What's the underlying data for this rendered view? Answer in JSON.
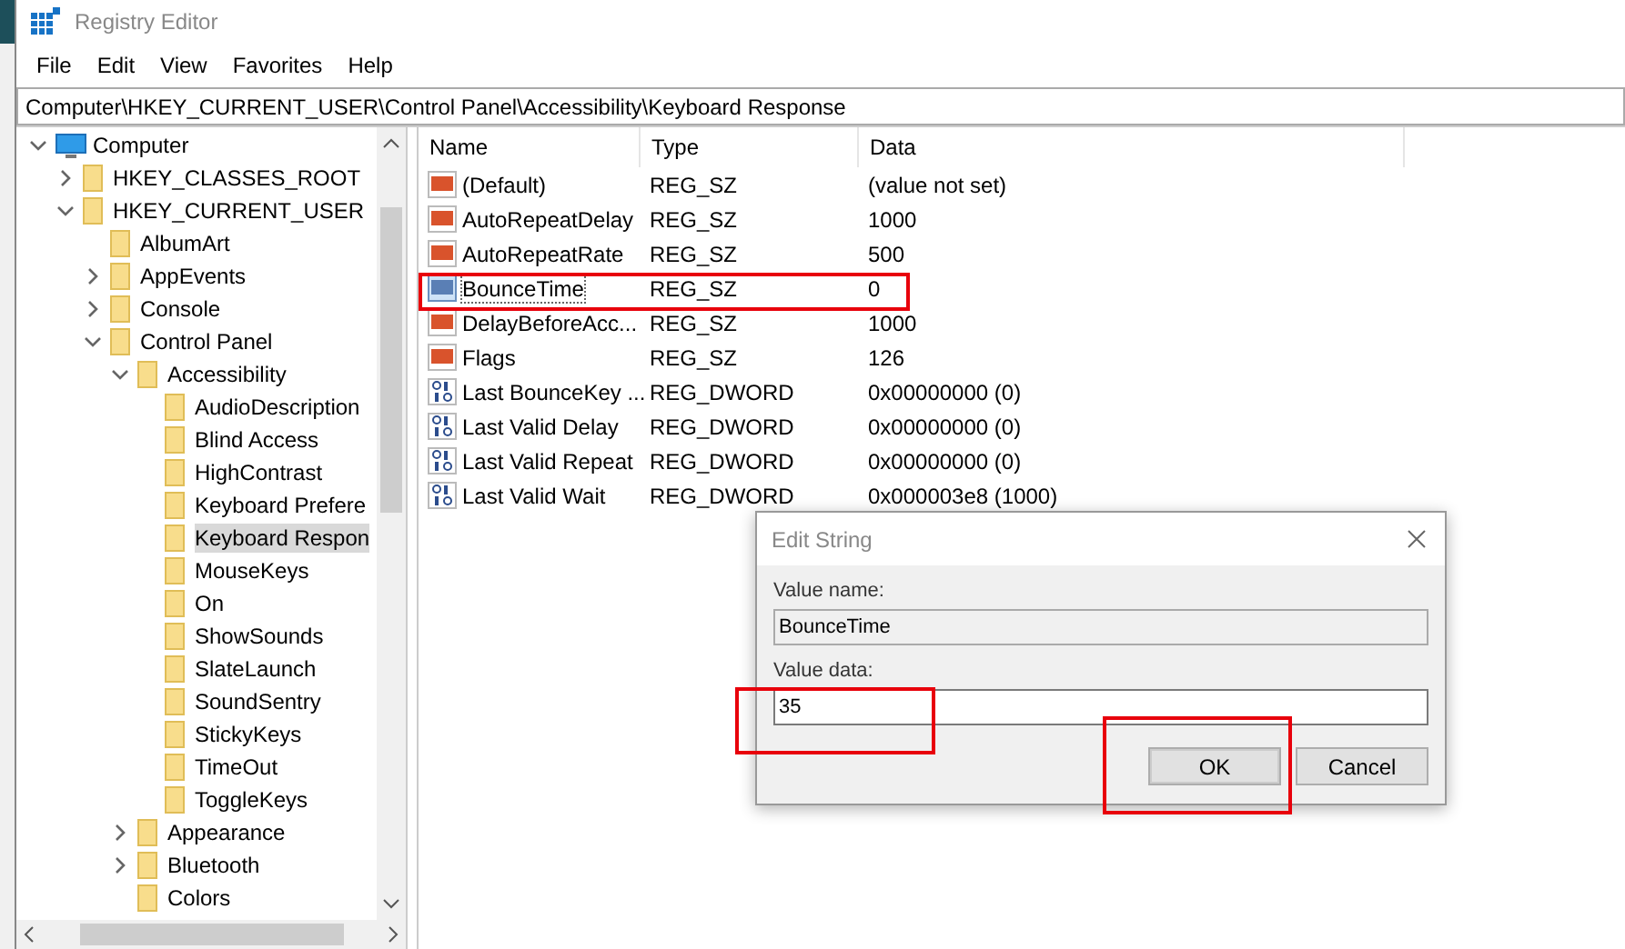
{
  "window": {
    "title": "Registry Editor"
  },
  "menu": [
    "File",
    "Edit",
    "View",
    "Favorites",
    "Help"
  ],
  "address": "Computer\\HKEY_CURRENT_USER\\Control Panel\\Accessibility\\Keyboard Response",
  "tree": [
    {
      "label": "Computer",
      "kind": "computer",
      "expanded": true,
      "selected": false,
      "children": [
        {
          "label": "HKEY_CLASSES_ROOT",
          "kind": "folder",
          "expanded": false,
          "selected": false
        },
        {
          "label": "HKEY_CURRENT_USER",
          "kind": "folder",
          "expanded": true,
          "selected": false,
          "children": [
            {
              "label": "AlbumArt",
              "kind": "folder",
              "selected": false
            },
            {
              "label": "AppEvents",
              "kind": "folder",
              "expanded": false,
              "selected": false
            },
            {
              "label": "Console",
              "kind": "folder",
              "expanded": false,
              "selected": false
            },
            {
              "label": "Control Panel",
              "kind": "folder",
              "expanded": true,
              "selected": false,
              "children": [
                {
                  "label": "Accessibility",
                  "kind": "folder",
                  "expanded": true,
                  "selected": false,
                  "children": [
                    {
                      "label": "AudioDescription",
                      "kind": "folder",
                      "selected": false
                    },
                    {
                      "label": "Blind Access",
                      "kind": "folder",
                      "selected": false
                    },
                    {
                      "label": "HighContrast",
                      "kind": "folder",
                      "selected": false
                    },
                    {
                      "label": "Keyboard Prefere",
                      "kind": "folder",
                      "selected": false
                    },
                    {
                      "label": "Keyboard Respon",
                      "kind": "folder",
                      "selected": true
                    },
                    {
                      "label": "MouseKeys",
                      "kind": "folder",
                      "selected": false
                    },
                    {
                      "label": "On",
                      "kind": "folder",
                      "selected": false
                    },
                    {
                      "label": "ShowSounds",
                      "kind": "folder",
                      "selected": false
                    },
                    {
                      "label": "SlateLaunch",
                      "kind": "folder",
                      "selected": false
                    },
                    {
                      "label": "SoundSentry",
                      "kind": "folder",
                      "selected": false
                    },
                    {
                      "label": "StickyKeys",
                      "kind": "folder",
                      "selected": false
                    },
                    {
                      "label": "TimeOut",
                      "kind": "folder",
                      "selected": false
                    },
                    {
                      "label": "ToggleKeys",
                      "kind": "folder",
                      "selected": false
                    }
                  ]
                },
                {
                  "label": "Appearance",
                  "kind": "folder",
                  "expanded": false,
                  "selected": false
                },
                {
                  "label": "Bluetooth",
                  "kind": "folder",
                  "expanded": false,
                  "selected": false
                },
                {
                  "label": "Colors",
                  "kind": "folder",
                  "selected": false
                }
              ]
            }
          ]
        }
      ]
    }
  ],
  "table": {
    "columns": [
      "Name",
      "Type",
      "Data"
    ],
    "rows": [
      {
        "kind": "string",
        "name": "(Default)",
        "type": "REG_SZ",
        "data": "(value not set)",
        "selected": false
      },
      {
        "kind": "string",
        "name": "AutoRepeatDelay",
        "type": "REG_SZ",
        "data": "1000",
        "selected": false
      },
      {
        "kind": "string",
        "name": "AutoRepeatRate",
        "type": "REG_SZ",
        "data": "500",
        "selected": false
      },
      {
        "kind": "string",
        "name": "BounceTime",
        "type": "REG_SZ",
        "data": "0",
        "selected": true
      },
      {
        "kind": "string",
        "name": "DelayBeforeAcc...",
        "type": "REG_SZ",
        "data": "1000",
        "selected": false
      },
      {
        "kind": "string",
        "name": "Flags",
        "type": "REG_SZ",
        "data": "126",
        "selected": false
      },
      {
        "kind": "binary",
        "name": "Last BounceKey ...",
        "type": "REG_DWORD",
        "data": "0x00000000 (0)",
        "selected": false
      },
      {
        "kind": "binary",
        "name": "Last Valid Delay",
        "type": "REG_DWORD",
        "data": "0x00000000 (0)",
        "selected": false
      },
      {
        "kind": "binary",
        "name": "Last Valid Repeat",
        "type": "REG_DWORD",
        "data": "0x00000000 (0)",
        "selected": false
      },
      {
        "kind": "binary",
        "name": "Last Valid Wait",
        "type": "REG_DWORD",
        "data": "0x000003e8 (1000)",
        "selected": false
      }
    ]
  },
  "dialog": {
    "title": "Edit String",
    "name_label": "Value name:",
    "name_value": "BounceTime",
    "data_label": "Value data:",
    "data_value": "35",
    "buttons": [
      {
        "label": "OK",
        "default": true
      },
      {
        "label": "Cancel",
        "default": false
      }
    ]
  }
}
